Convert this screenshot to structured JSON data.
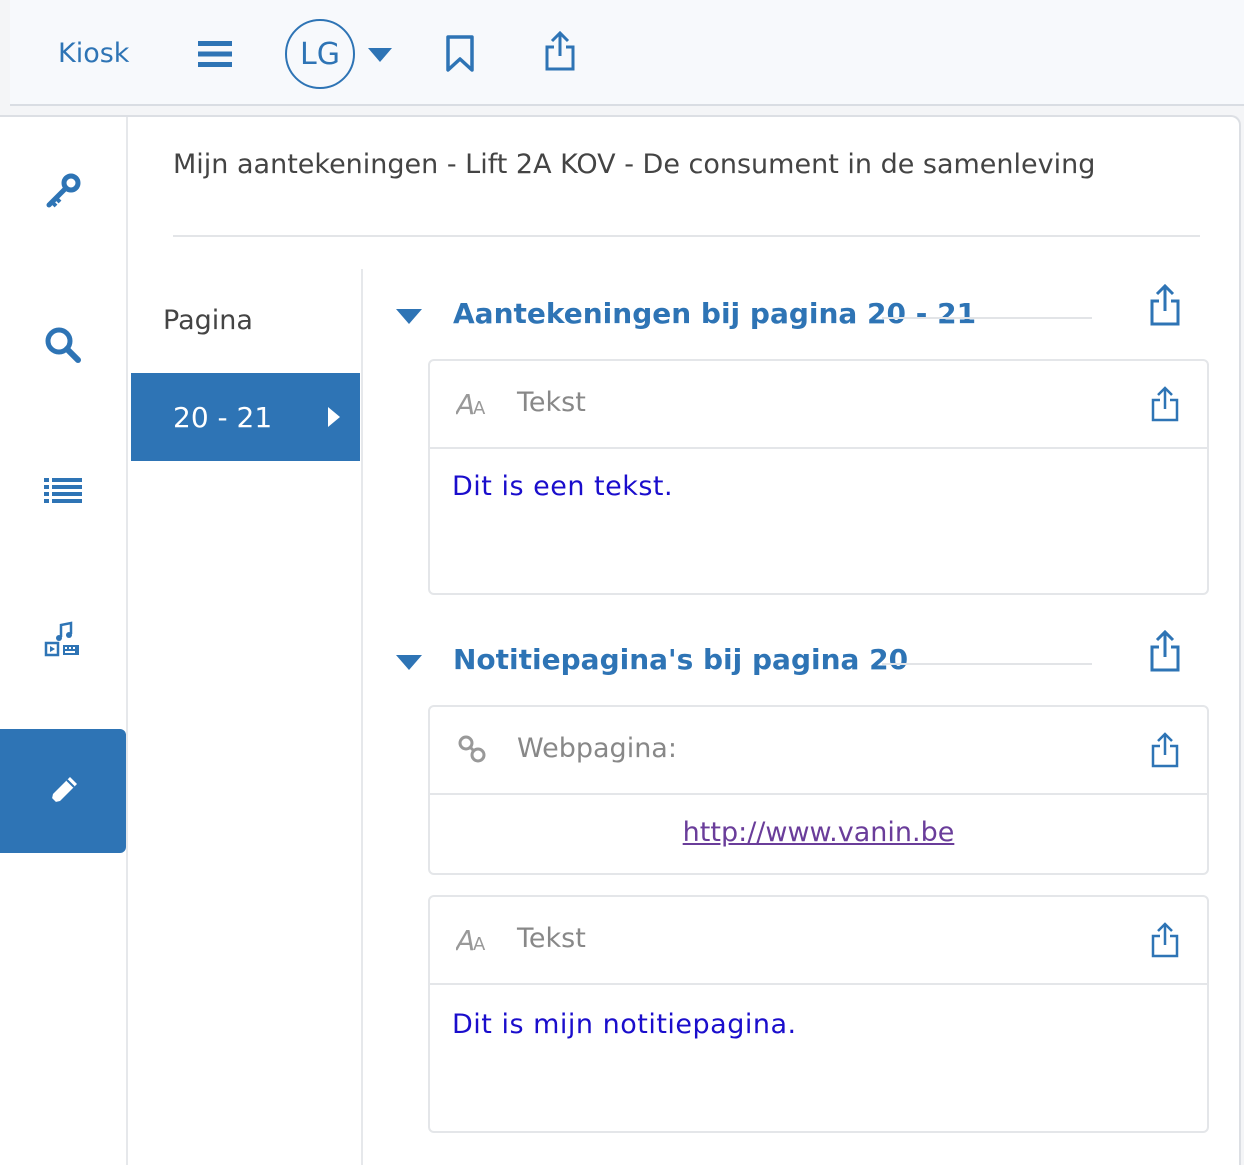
{
  "toolbar": {
    "kiosk_label": "Kiosk",
    "avatar_initials": "LG"
  },
  "panel": {
    "title": "Mijn aantekeningen - Lift 2A KOV - De consument in de samenleving"
  },
  "pages": {
    "header": "Pagina",
    "items": [
      {
        "label": "20 - 21",
        "selected": true
      }
    ]
  },
  "sections": [
    {
      "title": "Aantekeningen bij pagina 20 - 21",
      "cards": [
        {
          "type_label": "Tekst",
          "icon": "text-format-icon",
          "content": "Dit is een tekst."
        }
      ]
    },
    {
      "title": "Notitiepagina's bij pagina 20",
      "cards": [
        {
          "type_label": "Webpagina:",
          "icon": "link-icon",
          "link": "http://www.vanin.be"
        },
        {
          "type_label": "Tekst",
          "icon": "text-format-icon",
          "content": "Dit is mijn notitiepagina."
        }
      ]
    }
  ],
  "colors": {
    "accent": "#2e74b5",
    "note_text": "#1a0dcc",
    "link": "#6a3d9a"
  },
  "sidebar_icons": [
    "key-icon",
    "search-icon",
    "list-icon",
    "media-icon",
    "pencil-icon"
  ]
}
